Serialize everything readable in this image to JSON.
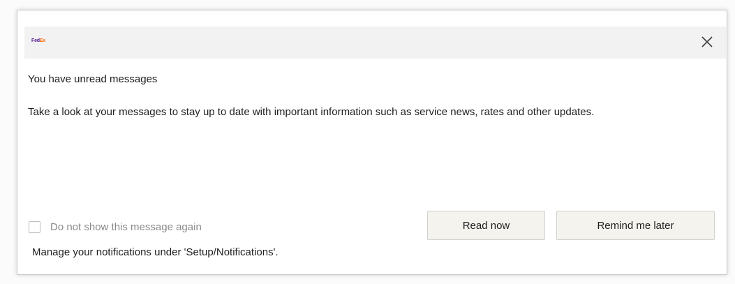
{
  "dialog": {
    "brand": {
      "fed": "Fed",
      "ex": "Ex"
    },
    "heading": "You have unread messages",
    "body": "Take a look at your messages to stay up to date with important information such as service news, rates and other updates.",
    "dont_show_label": "Do not show this message again",
    "dont_show_checked": false,
    "manage_text": "Manage your notifications under 'Setup/Notifications'.",
    "buttons": {
      "read_now": "Read now",
      "remind_later": "Remind me later"
    },
    "icons": {
      "close": "close-icon",
      "checkbox": "checkbox-icon"
    },
    "colors": {
      "brand_purple": "#4d148c",
      "brand_orange": "#ff6600",
      "button_bg": "#f4f3ee",
      "header_bg": "#f2f2f2",
      "text": "#1e1e1e",
      "muted_text": "#8a8a8a"
    }
  }
}
